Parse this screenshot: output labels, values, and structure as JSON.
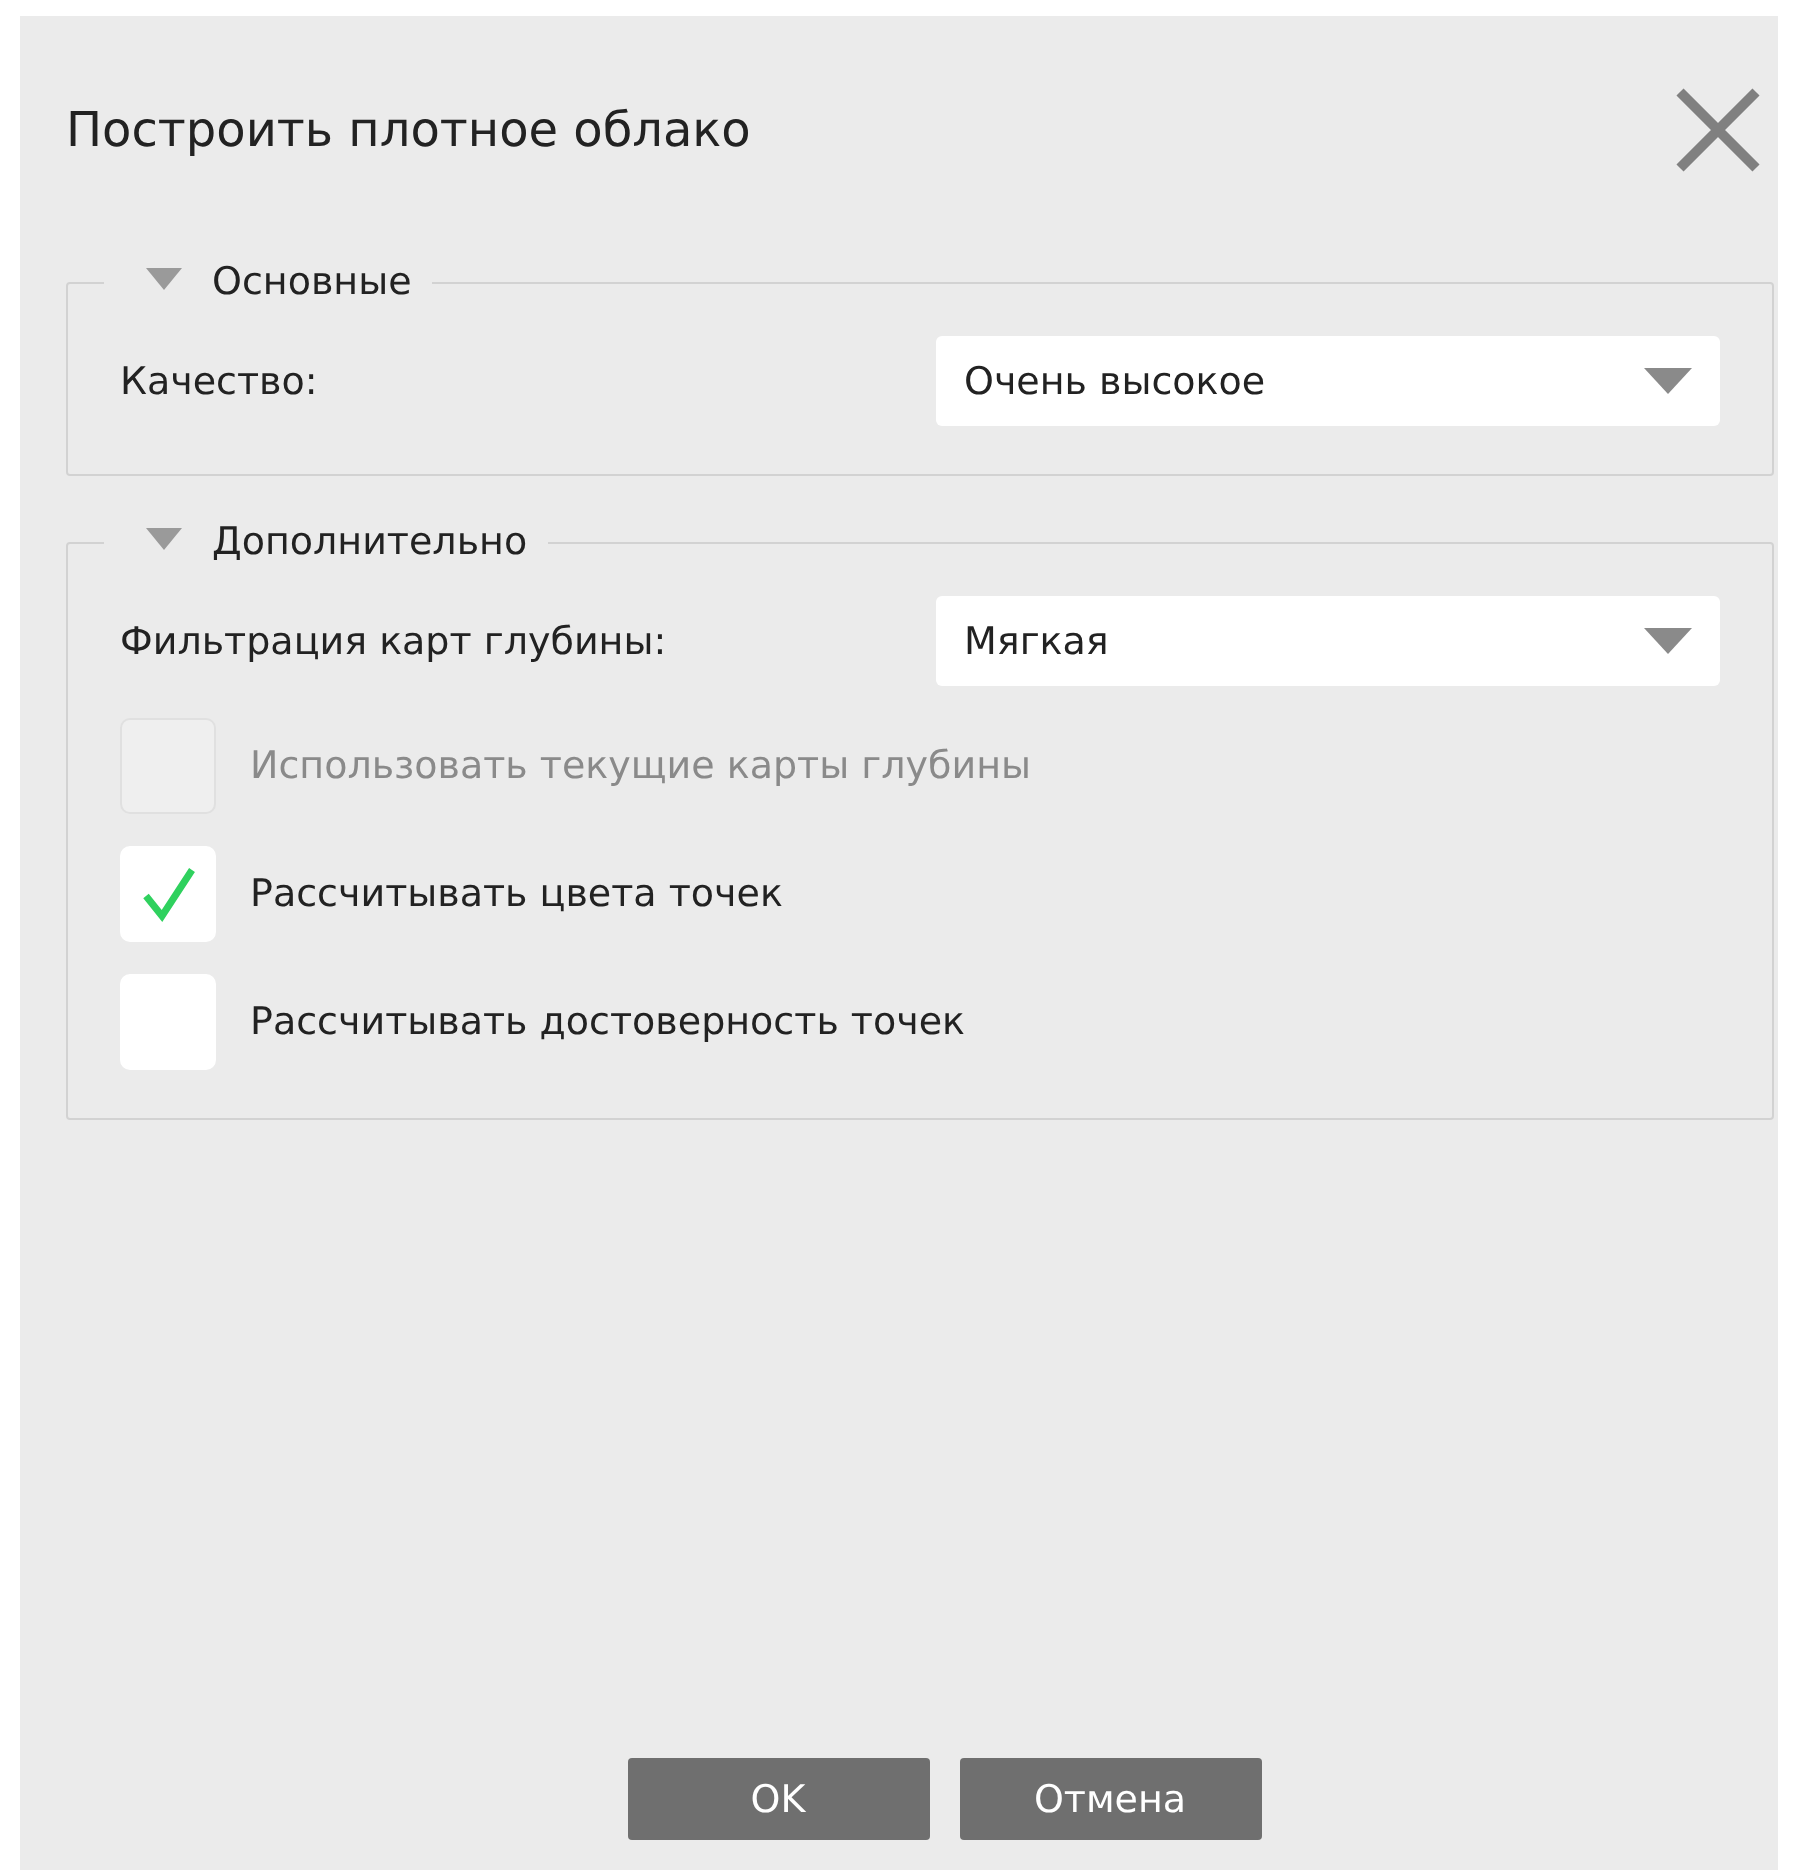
{
  "window": {
    "title": "Построить плотное облако"
  },
  "sections": [
    {
      "title": "Основные",
      "expanded": true,
      "rows": [
        {
          "kind": "select",
          "label": "Качество:",
          "value": "Очень высокое"
        }
      ]
    },
    {
      "title": "Дополнительно",
      "expanded": true,
      "rows": [
        {
          "kind": "select",
          "label": "Фильтрация карт глубины:",
          "value": "Мягкая"
        },
        {
          "kind": "checkbox",
          "label": "Использовать текущие карты глубины",
          "checked": false,
          "disabled": true
        },
        {
          "kind": "checkbox",
          "label": "Рассчитывать цвета точек",
          "checked": true,
          "disabled": false
        },
        {
          "kind": "checkbox",
          "label": "Рассчитывать достоверность точек",
          "checked": false,
          "disabled": false
        }
      ]
    }
  ],
  "buttons": [
    {
      "label": "OK"
    },
    {
      "label": "Отмена"
    }
  ]
}
